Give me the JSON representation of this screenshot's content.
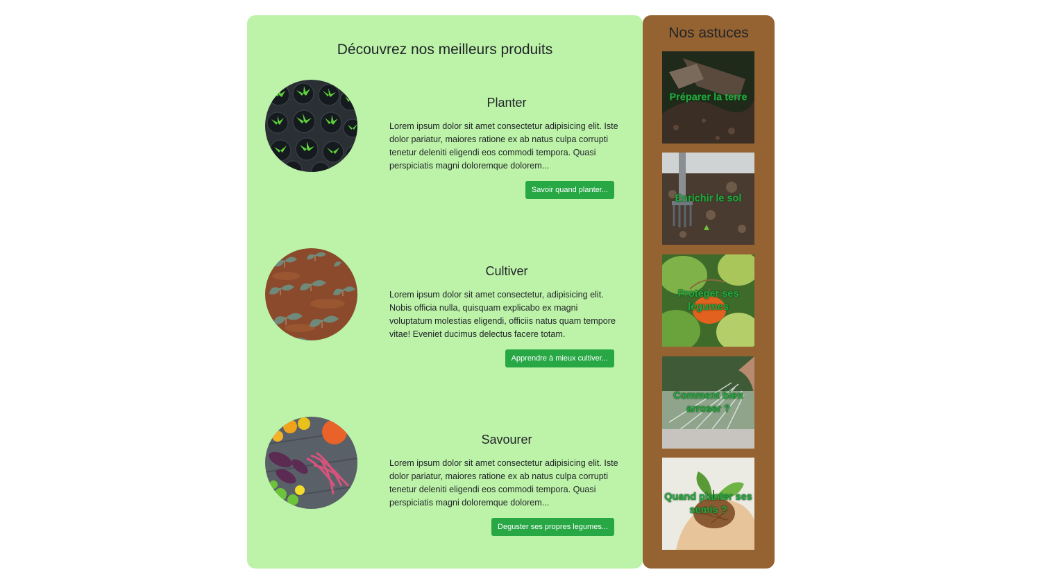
{
  "main": {
    "title": "Découvrez nos meilleurs produits",
    "products": [
      {
        "title": "Planter",
        "text": "Lorem ipsum dolor sit amet consectetur adipisicing elit. Iste dolor pariatur, maiores ratione ex ab natus culpa corrupti tenetur deleniti eligendi eos commodi tempora. Quasi perspiciatis magni doloremque dolorem...",
        "button": "Savoir quand planter..."
      },
      {
        "title": "Cultiver",
        "text": "Lorem ipsum dolor sit amet consectetur, adipisicing elit. Nobis officia nulla, quisquam explicabo ex magni voluptatum molestias eligendi, officiis natus quam tempore vitae! Eveniet ducimus delectus facere totam.",
        "button": "Apprendre à mieux cultiver..."
      },
      {
        "title": "Savourer",
        "text": "Lorem ipsum dolor sit amet consectetur adipisicing elit. Iste dolor pariatur, maiores ratione ex ab natus culpa corrupti tenetur deleniti eligendi eos commodi tempora. Quasi perspiciatis magni doloremque dolorem...",
        "button": "Deguster ses propres legumes..."
      }
    ]
  },
  "sidebar": {
    "title": "Nos astuces",
    "tips": [
      {
        "label": "Préparer la terre"
      },
      {
        "label": "Enrichir le sol"
      },
      {
        "label": "Protéger ses légumes"
      },
      {
        "label": "Comment bien arroser ?"
      },
      {
        "label": "Quand planter ses semis ?"
      }
    ]
  },
  "colors": {
    "main_background": "#bdf2a9",
    "sidebar_background": "#956331",
    "button": "#28a745",
    "tip_label": "#28a745"
  }
}
